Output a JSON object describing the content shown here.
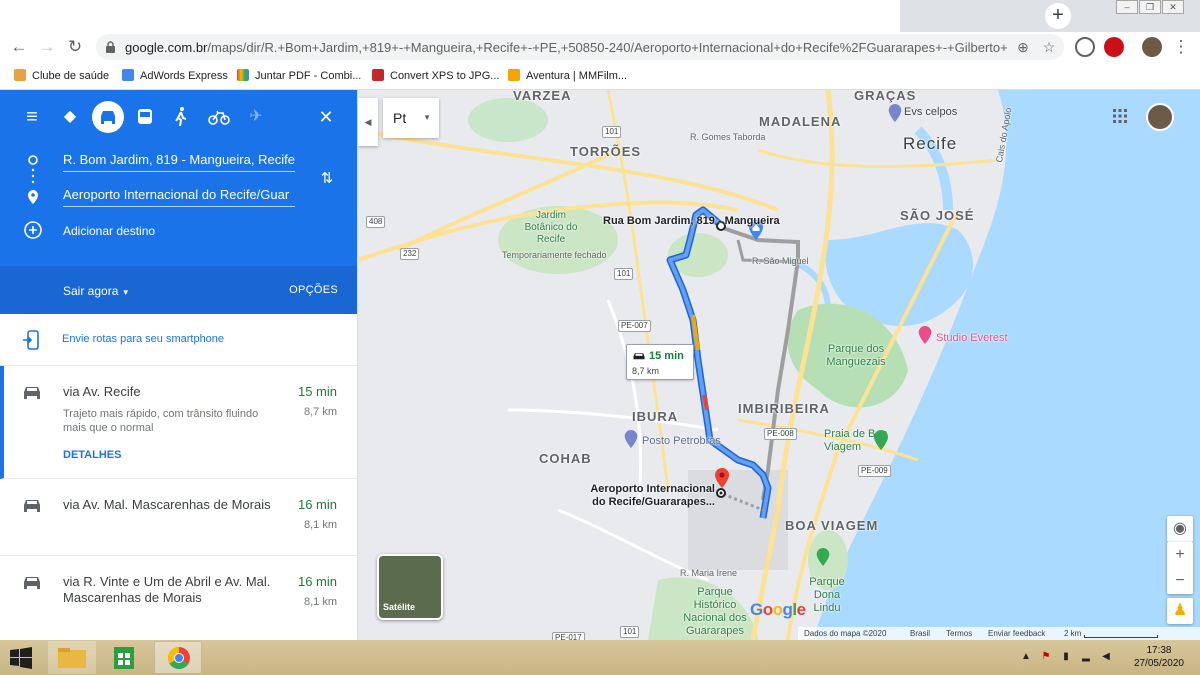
{
  "browser": {
    "url_domain": "google.com.br",
    "url_path": "/maps/dir/R.+Bom+Jardim,+819+-+Mangueira,+Recife+-+PE,+50850-240/Aeroporto+Internacional+do+Recife%2FGuararapes+-+Gilberto+Frey...",
    "new_tab": "+",
    "window_controls": [
      "–",
      "❐",
      "✕"
    ],
    "bookmarks": [
      {
        "label": "Clube de saúde",
        "color": "#e8a33d"
      },
      {
        "label": "AdWords Express",
        "color": "#4285f4"
      },
      {
        "label": "Juntar PDF - Combi...",
        "color": "#e94235"
      },
      {
        "label": "Convert XPS to JPG...",
        "color": "#c62828"
      },
      {
        "label": "Aventura | MMFilm...",
        "color": "#f4a300"
      }
    ]
  },
  "directions": {
    "origin": "R. Bom Jardim, 819 - Mangueira, Recife",
    "destination": "Aeroporto Internacional do Recife/Guar",
    "add_destination": "Adicionar destino",
    "leave_now": "Sair agora",
    "options": "OPÇÕES",
    "send_to_phone": "Envie rotas para seu smartphone",
    "routes": [
      {
        "via": "via Av. Recife",
        "time": "15 min",
        "distance": "8,7 km",
        "description": "Trajeto mais rápido, com trânsito fluindo mais que o normal",
        "details": "DETALHES"
      },
      {
        "via": "via Av. Mal. Mascarenhas de Morais",
        "time": "16 min",
        "distance": "8,1 km"
      },
      {
        "via": "via R. Vinte e Um de Abril e Av. Mal. Mascarenhas de Morais",
        "time": "16 min",
        "distance": "8,1 km"
      }
    ]
  },
  "map": {
    "layer_select": "Pt",
    "districts": [
      "VARZEA",
      "MADALENA",
      "Recife",
      "TORRÕES",
      "SÃO JOSÉ",
      "IBURA",
      "IMBIRIBEIRA",
      "COHAB",
      "BOA VIAGEM"
    ],
    "origin_label": "Rua Bom Jardim, 819 - Mangueira",
    "destination_label": "Aeroporto Internacional do Recife/Guararapes...",
    "route_box": {
      "time": "15 min",
      "distance": "8,7 km"
    },
    "places": {
      "jardim_botanico": "Jardim Botânico do Recife",
      "jb_status": "Temporariamente fechado",
      "parque_manguezais": "Parque dos Manguezais",
      "praia_boa_viagem": "Praia de Boa Viagem",
      "studio": "Studio Everest",
      "posto": "Posto Petrobras",
      "evs": "Evs celpos",
      "parque_lindu": "Parque Dona Lindu",
      "parque_guararapes": "Parque Histórico Nacional dos Guararapes",
      "graças": "GRAÇAS"
    },
    "streets": [
      "R. Gomes Taborda",
      "R. São Miguel",
      "R. Maria Irene",
      "Cais do Apolo"
    ],
    "shields": [
      "101",
      "408",
      "232",
      "101",
      "PE-007",
      "PE-008",
      "PE-009",
      "101",
      "PE-017"
    ],
    "satellite": "Satélite",
    "zoom_in": "+",
    "zoom_out": "−",
    "footer": {
      "data": "Dados do mapa ©2020",
      "country": "Brasil",
      "terms": "Termos",
      "feedback": "Enviar feedback",
      "scale": "2 km"
    },
    "google": "Google"
  },
  "taskbar": {
    "time": "17:38",
    "date": "27/05/2020"
  },
  "colors": {
    "blue": "#1a73e8",
    "route": "#669df6",
    "green": "#188038",
    "water": "#aadaff",
    "taskbar": "#c9b786"
  }
}
